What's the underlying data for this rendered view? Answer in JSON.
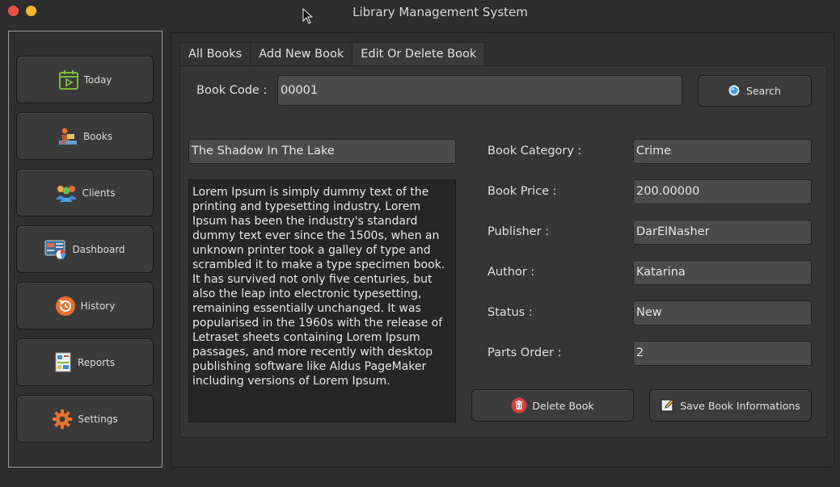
{
  "window": {
    "title": "Library Management System"
  },
  "sidebar": {
    "items": [
      {
        "label": "Today",
        "icon": "calendar-icon"
      },
      {
        "label": "Books",
        "icon": "reader-icon"
      },
      {
        "label": "Clients",
        "icon": "users-icon"
      },
      {
        "label": "Dashboard",
        "icon": "dashboard-icon"
      },
      {
        "label": "History",
        "icon": "history-icon"
      },
      {
        "label": "Reports",
        "icon": "reports-icon"
      },
      {
        "label": "Settings",
        "icon": "gear-icon"
      }
    ]
  },
  "tabs": [
    {
      "label": "All Books"
    },
    {
      "label": "Add New Book"
    },
    {
      "label": "Edit Or Delete Book",
      "active": true
    }
  ],
  "search": {
    "code_label": "Book Code :",
    "code_value": "00001",
    "button_label": "Search"
  },
  "book": {
    "title": "The Shadow In The Lake",
    "description": "Lorem Ipsum is simply dummy text of the printing and typesetting industry. Lorem Ipsum has been the industry's standard dummy text ever since the 1500s, when an unknown printer took a galley of type and scrambled it to make a type specimen book. It has survived not only five centuries, but also the leap into electronic typesetting, remaining essentially unchanged. It was popularised in the 1960s with the release of Letraset sheets containing Lorem Ipsum passages, and more recently with desktop publishing software like Aldus PageMaker including versions of Lorem Ipsum.",
    "category_label": "Book Category :",
    "category": "Crime",
    "price_label": "Book Price :",
    "price": "200.00000",
    "publisher_label": "Publisher :",
    "publisher": "DarElNasher",
    "author_label": "Author :",
    "author": "Katarina",
    "status_label": "Status :",
    "status": "New",
    "parts_label": "Parts Order :",
    "parts": "2"
  },
  "actions": {
    "delete_label": "Delete Book",
    "save_label": "Save Book Informations"
  },
  "colors": {
    "close": "#ee5047",
    "minimize": "#f6b72a",
    "accent_green": "#7dbb3c",
    "accent_orange": "#e8712b",
    "delete_red": "#d9403a"
  }
}
